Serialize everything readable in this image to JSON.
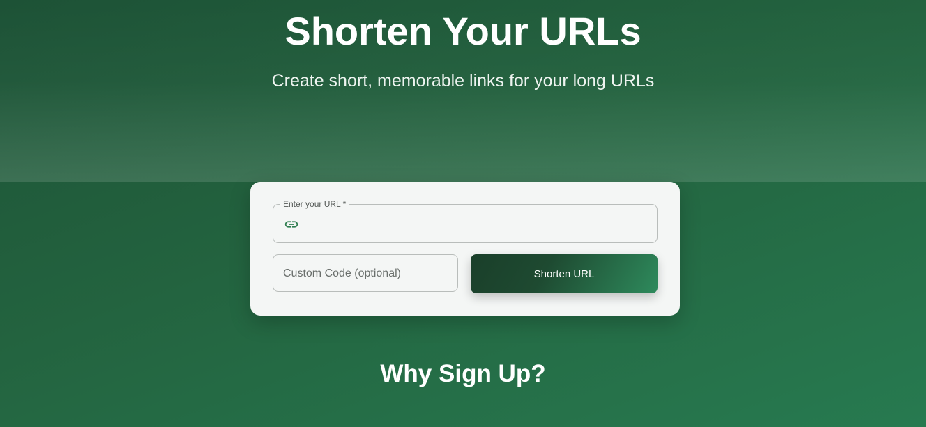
{
  "hero": {
    "title": "Shorten Your URLs",
    "subtitle": "Create short, memorable links for your long URLs"
  },
  "form": {
    "url_label": "Enter your URL *",
    "url_value": "",
    "url_icon": "link-icon",
    "custom_code_placeholder": "Custom Code (optional)",
    "custom_code_value": "",
    "submit_label": "Shorten URL"
  },
  "section": {
    "why_title": "Why Sign Up?"
  },
  "colors": {
    "accent": "#2e7d4f",
    "button_dark": "#1a3f2a",
    "button_light": "#2e8a5c"
  }
}
